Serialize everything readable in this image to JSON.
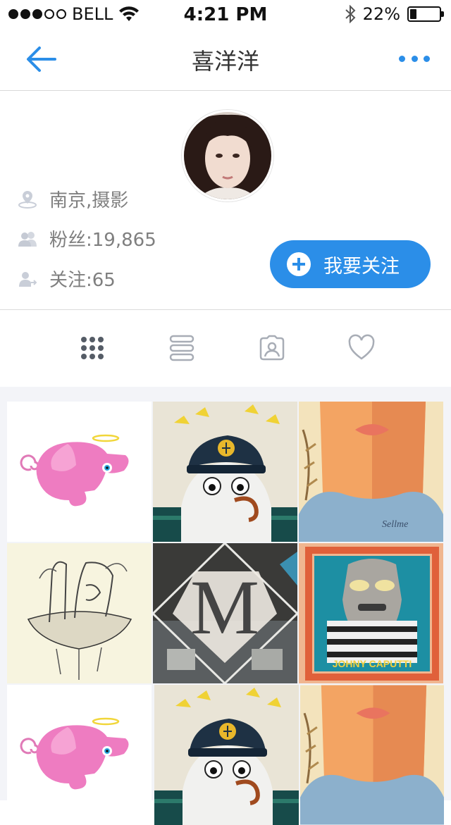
{
  "status_bar": {
    "carrier": "BELL",
    "time": "4:21 PM",
    "battery_percent": "22%",
    "battery_level": 0.22
  },
  "nav": {
    "title": "喜洋洋"
  },
  "profile": {
    "location": "南京,摄影",
    "fans": "粉丝:19,865",
    "following": "关注:65",
    "follow_button": "我要关注"
  },
  "tabs": [
    {
      "name": "grid-tab",
      "icon": "grid-icon",
      "active": true
    },
    {
      "name": "list-tab",
      "icon": "list-icon",
      "active": false
    },
    {
      "name": "portrait-tab",
      "icon": "portrait-icon",
      "active": false
    },
    {
      "name": "likes-tab",
      "icon": "heart-icon",
      "active": false
    }
  ],
  "photos": [
    {
      "subject": "pink elephant"
    },
    {
      "subject": "sailor with seagulls"
    },
    {
      "subject": "girl portrait"
    },
    {
      "subject": "tree island sketch"
    },
    {
      "subject": "letter M"
    },
    {
      "subject": "framed character",
      "caption": "JOHNY CAPUTTI"
    },
    {
      "subject": "pink elephant"
    },
    {
      "subject": "sailor with seagulls"
    },
    {
      "subject": "girl portrait"
    }
  ],
  "colors": {
    "accent": "#2b8ee8",
    "muted_text": "#7f7f7f",
    "grid_bg": "#f3f4f8"
  }
}
